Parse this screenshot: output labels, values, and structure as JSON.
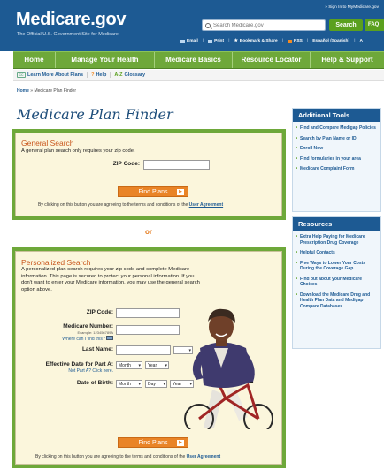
{
  "header": {
    "logo": "Medicare.gov",
    "tagline": "The Official U.S. Government Site for Medicare",
    "signin": "» Sign In to MyMedicare.gov",
    "search_placeholder": "Search Medicare.gov",
    "search_button": "Search",
    "faq_button": "FAQ",
    "tools": [
      "Email",
      "Print",
      "Bookmark & Share",
      "RSS",
      "Español (Spanish)",
      "A"
    ]
  },
  "nav": {
    "tabs": [
      "Home",
      "Manage Your Health",
      "Medicare Basics",
      "Resource Locator",
      "Help & Support"
    ]
  },
  "subbar": {
    "items": [
      "Learn More About Plans",
      "Help",
      "Glossary"
    ],
    "cc_icon": "CC",
    "help_icon": "?",
    "glossary_icon": "A-Z"
  },
  "breadcrumb": {
    "home": "Home",
    "current": " » Medicare Plan Finder"
  },
  "page_title": "Medicare Plan Finder",
  "general": {
    "title": "General Search",
    "intro": "A general plan search only requires your zip code.",
    "zip_label": "ZIP Code:",
    "button": "Find Plans",
    "agree_text": "By clicking on this button you are agreeing to the terms and conditions of the ",
    "agree_link": "User Agreement"
  },
  "or_text": "or",
  "personalized": {
    "title": "Personalized Search",
    "intro": "A personalized plan search requires your zip code and complete Medicare information. This page is secured to protect your personal information. If you don't want to enter your Medicare information, you may use the general search option above.",
    "zip_label": "ZIP Code:",
    "medicare_label": "Medicare Number:",
    "medicare_example": "Example: 123456789A",
    "medicare_where": "Where can I find this?",
    "last_name_label": "Last Name:",
    "effective_label": "Effective Date for Part A:",
    "not_part_a": "Not Part A? Click here.",
    "dob_label": "Date of Birth:",
    "month": "Month",
    "year": "Year",
    "day": "Day",
    "button": "Find Plans",
    "agree_text": "By clicking on this button you are agreeing to the terms and conditions of the ",
    "agree_link": "User Agreement"
  },
  "sidebar": {
    "tools_title": "Additional Tools",
    "tools": [
      "Find and Compare Medigap Policies",
      "Search by Plan Name or ID",
      "Enroll Now",
      "Find formularies in your area",
      "Medicare Complaint Form"
    ],
    "resources_title": "Resources",
    "resources": [
      "Extra Help Paying for Medicare Prescription Drug Coverage",
      "Helpful Contacts",
      "Five Ways to Lower Your Costs During the Coverage Gap",
      "Find out about your Medicare Choices",
      "Download the Medicare Drug and Health Plan Data and Medigap Compare Databases"
    ]
  },
  "colors": {
    "header_blue": "#1d5a93",
    "nav_green": "#6ea83a",
    "accent_orange": "#e98427",
    "panel_bg": "#fbf6dc"
  }
}
